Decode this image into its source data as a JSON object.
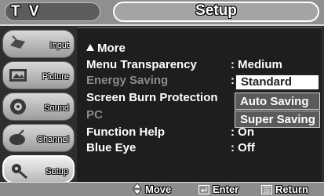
{
  "header": {
    "tv_label": "T V",
    "title": "Setup"
  },
  "nav": {
    "items": [
      {
        "label": "Input",
        "icon": "input-icon"
      },
      {
        "label": "Picture",
        "icon": "picture-icon"
      },
      {
        "label": "Sound",
        "icon": "sound-icon"
      },
      {
        "label": "Channel",
        "icon": "channel-icon"
      },
      {
        "label": "Setup",
        "icon": "setup-icon",
        "selected": true
      }
    ]
  },
  "menu": {
    "more_label": "More",
    "more_icon": "up-arrow-icon",
    "items": [
      {
        "label": "Menu Transparency",
        "value": ": Medium"
      },
      {
        "label": "Energy Saving",
        "value": ":",
        "state": "active"
      },
      {
        "label": "Screen Burn Protection",
        "value": ""
      },
      {
        "label": "PC",
        "value": "",
        "state": "disabled"
      },
      {
        "label": "Function Help",
        "value": ": On"
      },
      {
        "label": "Blue Eye",
        "value": ": Off"
      }
    ]
  },
  "dropdown": {
    "options": [
      "Standard",
      "Auto Saving",
      "Super Saving"
    ],
    "selected": "Standard"
  },
  "footer": {
    "move": "Move",
    "enter": "Enter",
    "return": "Return"
  },
  "colors": {
    "background": "#2e2e2e",
    "menu_background": "#1e1e1e",
    "bar": "#8f8f8f",
    "text": "#ffffff",
    "disabled_text": "#8a8a8a"
  }
}
